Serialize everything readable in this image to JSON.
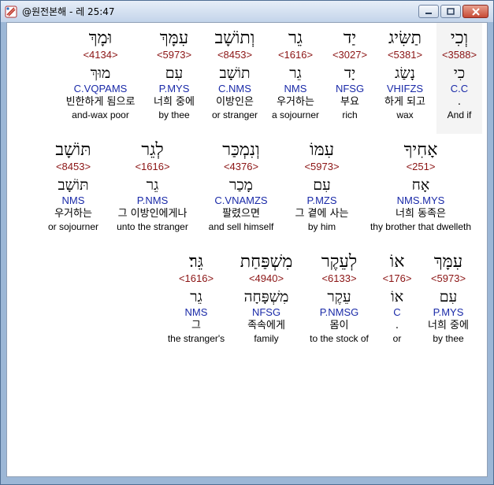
{
  "window": {
    "title": "@원전본해 - 레 25:47",
    "icon": "bible-app-icon"
  },
  "rows": [
    [
      {
        "heb": "וְכִי",
        "strong": "<3588>",
        "root": "כִי",
        "morph": "C.C",
        "kor": ".",
        "eng": "And if",
        "hl": true
      },
      {
        "heb": "תַשִּׂיג",
        "strong": "<5381>",
        "root": "נָשַׂג",
        "morph": "VHIFZS",
        "kor": "하게 되고",
        "eng": "wax"
      },
      {
        "heb": "יַד",
        "strong": "<3027>",
        "root": "יָד",
        "morph": "NFSG",
        "kor": "부요",
        "eng": "rich"
      },
      {
        "heb": "גֵר",
        "strong": "<1616>",
        "root": "גֵר",
        "morph": "NMS",
        "kor": "우거하는",
        "eng": "a sojourner"
      },
      {
        "heb": "וְתוֹשָׁב",
        "strong": "<8453>",
        "root": "תוֹשָׁב",
        "morph": "C.NMS",
        "kor": "이방인은",
        "eng": "or stranger"
      },
      {
        "heb": "עִמָּךְ",
        "strong": "<5973>",
        "root": "עִם",
        "morph": "P.MYS",
        "kor": "너희 중에",
        "eng": "by thee"
      },
      {
        "heb": "וּמָךְ",
        "strong": "<4134>",
        "root": "מוּךְ",
        "morph": "C.VQPAMS",
        "kor": "빈한하게 됨으로",
        "eng": "and-wax poor"
      }
    ],
    [
      {
        "heb": "אָחִיךָ",
        "strong": "<251>",
        "root": "אָח",
        "morph": "NMS.MYS",
        "kor": "너희 동족은",
        "eng": "thy brother that dwelleth"
      },
      {
        "heb": "עִמּוֹ",
        "strong": "<5973>",
        "root": "עִם",
        "morph": "P.MZS",
        "kor": "그 곁에 사는",
        "eng": "by him"
      },
      {
        "heb": "וְנִמְכַּר",
        "strong": "<4376>",
        "root": "מָכַר",
        "morph": "C.VNAMZS",
        "kor": "팔렸으면",
        "eng": "and sell himself"
      },
      {
        "heb": "לְגֵר",
        "strong": "<1616>",
        "root": "גֵר",
        "morph": "P.NMS",
        "kor": "그 이방인에게나",
        "eng": "unto the stranger"
      },
      {
        "heb": "תּוֹשָׁב",
        "strong": "<8453>",
        "root": "תּוֹשָׁב",
        "morph": "NMS",
        "kor": "우거하는",
        "eng": "or sojourner"
      }
    ],
    [
      {
        "heb": "עִמָּךְ",
        "strong": "<5973>",
        "root": "עִם",
        "morph": "P.MYS",
        "kor": "너희 중에",
        "eng": "by thee"
      },
      {
        "heb": "אוֹ",
        "strong": "<176>",
        "root": "אוֹ",
        "morph": "C",
        "kor": ".",
        "eng": "or"
      },
      {
        "heb": "לְעֵקֶר",
        "strong": "<6133>",
        "root": "עֵקֶר",
        "morph": "P.NMSG",
        "kor": "몸이",
        "eng": "to the stock of"
      },
      {
        "heb": "מִשְׁפַּחַת",
        "strong": "<4940>",
        "root": "מִשְׁפָּחָה",
        "morph": "NFSG",
        "kor": "족속에게",
        "eng": "family"
      },
      {
        "heb": "גֵּר׃",
        "strong": "<1616>",
        "root": "גֵר",
        "morph": "NMS",
        "kor": "그",
        "eng": "the stranger's"
      }
    ]
  ]
}
